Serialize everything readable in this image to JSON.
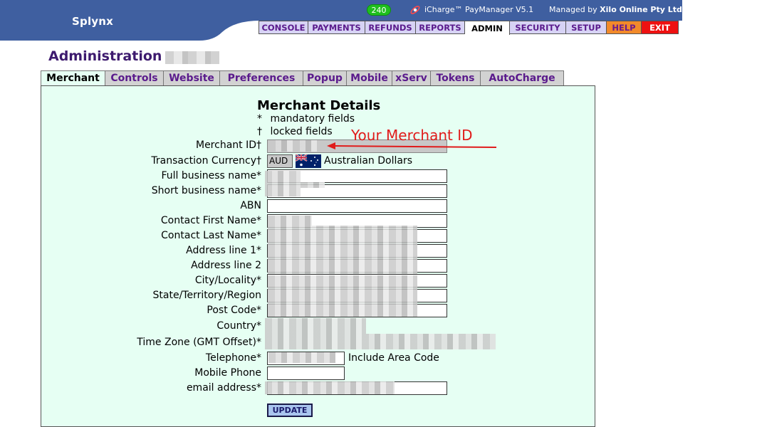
{
  "header": {
    "brand": "Splynx",
    "counter": "240",
    "product": "iCharge™ PayManager V5.1",
    "managed_prefix": "Managed by",
    "managed_by": "Xilo Online Pty Ltd",
    "colors": {
      "bar": "#3f5fa0",
      "nav": "#d7d3f5",
      "help": "#f28a2a",
      "exit": "#ee1111"
    }
  },
  "nav": [
    {
      "label": "CONSOLE",
      "name": "nav-console"
    },
    {
      "label": "PAYMENTS",
      "name": "nav-payments"
    },
    {
      "label": "REFUNDS",
      "name": "nav-refunds"
    },
    {
      "label": "REPORTS",
      "name": "nav-reports"
    },
    {
      "label": "ADMIN",
      "name": "nav-admin",
      "active": true
    },
    {
      "label": "SECURITY",
      "name": "nav-security"
    },
    {
      "label": "SETUP",
      "name": "nav-setup"
    },
    {
      "label": "HELP",
      "name": "nav-help"
    },
    {
      "label": "EXIT",
      "name": "nav-exit"
    }
  ],
  "page": {
    "title": "Administration"
  },
  "tabs": [
    {
      "label": "Merchant",
      "active": true
    },
    {
      "label": "Controls"
    },
    {
      "label": "Website"
    },
    {
      "label": "Preferences"
    },
    {
      "label": "Popup"
    },
    {
      "label": "Mobile"
    },
    {
      "label": "xServ"
    },
    {
      "label": "Tokens"
    },
    {
      "label": "AutoCharge"
    }
  ],
  "section": {
    "title": "Merchant Details",
    "mandatory_mark": "*",
    "mandatory_text": "mandatory fields",
    "locked_mark": "†",
    "locked_text": "locked fields"
  },
  "annotation": {
    "text": "Your Merchant ID",
    "color": "#e01b1b"
  },
  "fields": {
    "merchant_id": {
      "label": "Merchant ID†"
    },
    "currency": {
      "label": "Transaction Currency†",
      "code": "AUD",
      "name": "Australian Dollars"
    },
    "full_business_name": {
      "label": "Full business name*"
    },
    "short_business_name": {
      "label": "Short business name*"
    },
    "abn": {
      "label": "ABN"
    },
    "contact_first": {
      "label": "Contact First Name*"
    },
    "contact_last": {
      "label": "Contact Last Name*"
    },
    "address1": {
      "label": "Address line 1*"
    },
    "address2": {
      "label": "Address line 2"
    },
    "city": {
      "label": "City/Locality*"
    },
    "state": {
      "label": "State/Territory/Region"
    },
    "postcode": {
      "label": "Post Code*"
    },
    "country": {
      "label": "Country*"
    },
    "timezone": {
      "label": "Time Zone (GMT Offset)*"
    },
    "telephone": {
      "label": "Telephone*",
      "hint": "Include Area Code"
    },
    "mobile": {
      "label": "Mobile Phone"
    },
    "email": {
      "label": "email address*"
    }
  },
  "update_label": "UPDATE"
}
